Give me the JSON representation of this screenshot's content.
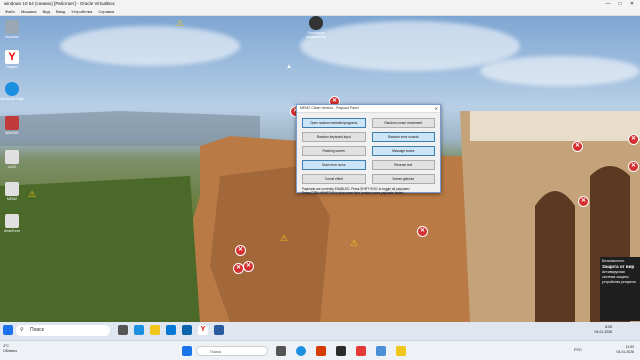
{
  "host_window": {
    "title": "windows 10 64 (снимок) [Работает] - Oracle VirtualBox",
    "menu": [
      "Файл",
      "Машина",
      "Вид",
      "Ввод",
      "Устройства",
      "Справка"
    ],
    "controls": [
      "—",
      "□",
      "✕"
    ]
  },
  "desktop_icons": [
    {
      "label": "Корзина",
      "color": "#9aa7b5"
    },
    {
      "label": "Яндекс",
      "color": "#ffffff"
    },
    {
      "label": "Microsoft Edge",
      "color": "#1b8fe0"
    },
    {
      "label": "WinRAR",
      "color": "#c23b3b"
    },
    {
      "label": "xc24",
      "color": "#e0e0e0"
    },
    {
      "label": "MEMZ",
      "color": "#e0e0e0"
    },
    {
      "label": "dmsr8 exe",
      "color": "#e0e0e0"
    }
  ],
  "top_icon": {
    "label": "Отключить расширения"
  },
  "dialog": {
    "title": "MEMZ Clean Version - Payload Panel",
    "close": "✕",
    "buttons": [
      {
        "label": "Open random websites/programs",
        "highlighted": true
      },
      {
        "label": "Random cursor movement",
        "highlighted": false
      },
      {
        "label": "Random keyboard input",
        "highlighted": false
      },
      {
        "label": "Random error sounds",
        "highlighted": true
      },
      {
        "label": "Flashing screen",
        "highlighted": false
      },
      {
        "label": "Message boxes",
        "highlighted": true
      },
      {
        "label": "Draw error icons",
        "highlighted": true
      },
      {
        "label": "Reverse text",
        "highlighted": false
      },
      {
        "label": "Tunnel effect",
        "highlighted": false
      },
      {
        "label": "Screen glitches",
        "highlighted": false
      }
    ],
    "note_line1": "Payloads are currently ENABLED. Press SHIFT+ESC to toggle all payloads!",
    "note_line2": "Press CTRL+SHIFT+S to skip some time (makes some payloads faster)"
  },
  "taskbar": {
    "search_icon": "magnifier-icon",
    "search_placeholder": "Поиск",
    "clock_time": "8:05",
    "clock_date": "04.01.2026"
  },
  "toast": {
    "header": "Безопасность",
    "title": "Защита от вир",
    "body": "Антивирусная система защиты устройства устарела"
  },
  "host_taskbar": {
    "weather_temp": "4°C",
    "weather_desc": "Облачно",
    "search_placeholder": "Поиск",
    "time": "11:53",
    "date": "04.01.2026",
    "lang": "РУС"
  },
  "colors": {
    "dialog_border": "#7a9ccc",
    "highlight": "#cce4f7",
    "error_red": "#d32f2f",
    "warning_yellow": "#f5c518"
  }
}
